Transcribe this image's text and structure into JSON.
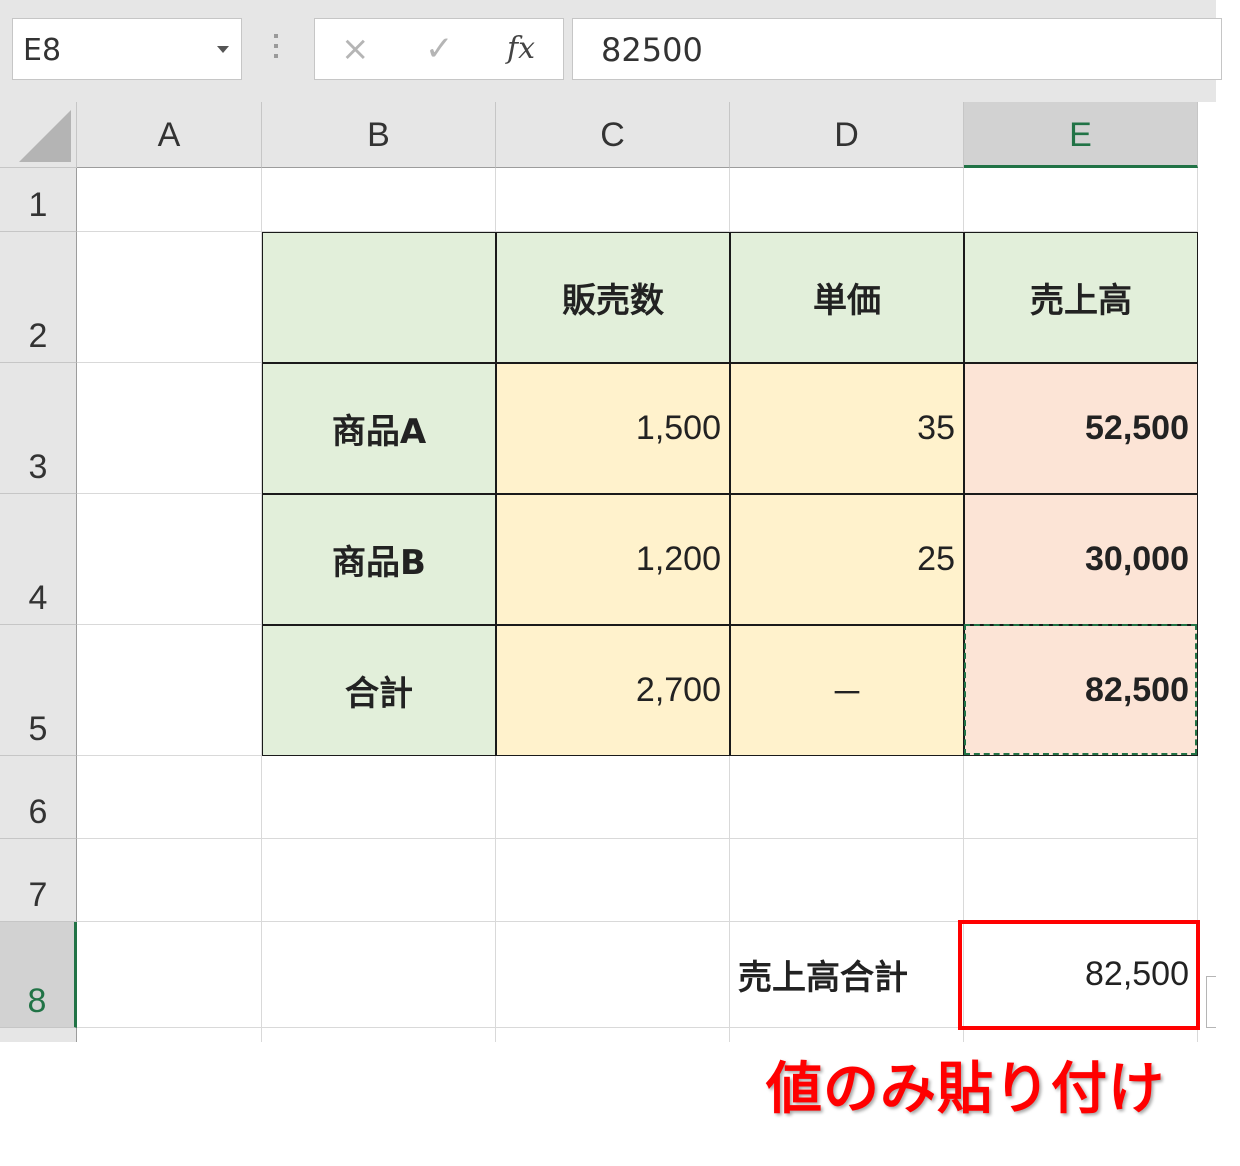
{
  "formula_bar": {
    "name_box": "E8",
    "cancel_icon": "×",
    "enter_icon": "✓",
    "function_icon": "fx",
    "formula_value": "82500"
  },
  "columns": [
    "A",
    "B",
    "C",
    "D",
    "E"
  ],
  "rows": [
    "1",
    "2",
    "3",
    "4",
    "5",
    "6",
    "7",
    "8"
  ],
  "table": {
    "header": {
      "corner": "",
      "sales_qty": "販売数",
      "unit_price": "単価",
      "revenue": "売上高"
    },
    "rows": [
      {
        "label": "商品A",
        "qty": "1,500",
        "price": "35",
        "revenue": "52,500"
      },
      {
        "label": "商品B",
        "qty": "1,200",
        "price": "25",
        "revenue": "30,000"
      },
      {
        "label": "合計",
        "qty": "2,700",
        "price": "－",
        "revenue": "82,500"
      }
    ]
  },
  "summary": {
    "label": "売上高合計",
    "value": "82,500"
  },
  "annotation": "値のみ貼り付け",
  "colors": {
    "header_green": "#e2efda",
    "value_yellow": "#fff2cc",
    "revenue_pink": "#fce4d6",
    "excel_green": "#217346",
    "highlight_red": "#ff0000"
  }
}
